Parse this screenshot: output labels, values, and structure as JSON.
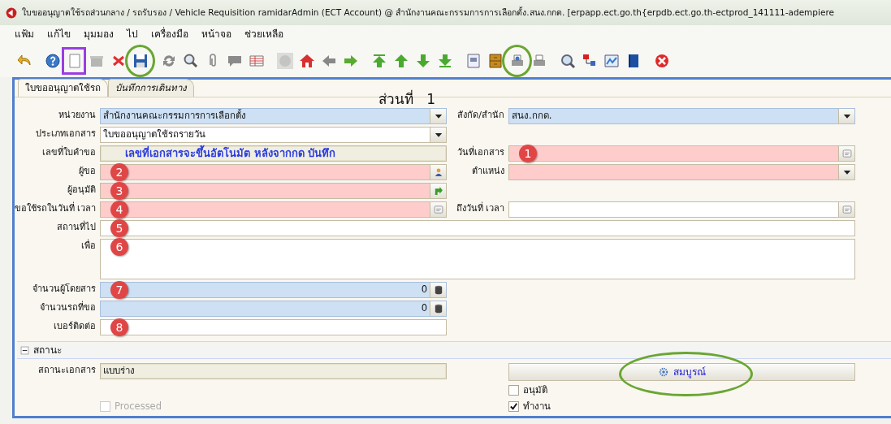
{
  "window": {
    "title": "ใบขออนุญาตใช้รถส่วนกลาง / รถรับรอง / Vehicle Requisition  ramidarAdmin (ECT Account) @ สำนักงานคณะกรรมการการเลือกตั้ง.สนง.กกต. [erpapp.ect.go.th{erpdb.ect.go.th-ectprod_141111-adempiere"
  },
  "menu": [
    "แฟ้ม",
    "แก้ไข",
    "มุมมอง",
    "ไป",
    "เครื่องมือ",
    "หน้าจอ",
    "ช่วยเหลือ"
  ],
  "toolbar": [
    {
      "kind": "undo",
      "disabled": false
    },
    {
      "kind": "help",
      "disabled": false
    },
    {
      "kind": "new",
      "disabled": false,
      "boxed": true
    },
    {
      "kind": "copy",
      "disabled": true
    },
    {
      "kind": "delete",
      "disabled": false
    },
    {
      "kind": "save",
      "disabled": false,
      "circled": true
    },
    {
      "kind": "refresh",
      "disabled": false
    },
    {
      "kind": "search",
      "disabled": false
    },
    {
      "kind": "attach",
      "disabled": false
    },
    {
      "kind": "chat",
      "disabled": false
    },
    {
      "kind": "grid",
      "disabled": false
    },
    {
      "kind": "history",
      "disabled": true
    },
    {
      "kind": "home",
      "disabled": false
    },
    {
      "kind": "left",
      "disabled": false
    },
    {
      "kind": "right",
      "disabled": false
    },
    {
      "kind": "first",
      "disabled": false
    },
    {
      "kind": "up",
      "disabled": false
    },
    {
      "kind": "down",
      "disabled": false
    },
    {
      "kind": "last",
      "disabled": false
    },
    {
      "kind": "report",
      "disabled": false
    },
    {
      "kind": "cabinet",
      "disabled": false
    },
    {
      "kind": "preview",
      "disabled": false,
      "circled": true
    },
    {
      "kind": "print",
      "disabled": false
    },
    {
      "kind": "zoom",
      "disabled": false
    },
    {
      "kind": "flow",
      "disabled": false
    },
    {
      "kind": "picture",
      "disabled": false
    },
    {
      "kind": "book",
      "disabled": false
    },
    {
      "kind": "close",
      "disabled": false
    }
  ],
  "tabs": [
    {
      "label": "ใบขออนุญาตใช้รถ",
      "selected": true
    },
    {
      "label": "บันทึกการเดินทาง",
      "selected": false
    }
  ],
  "section_title": "ส่วนที่   1",
  "rows": [
    {
      "left": {
        "label": "หน่วยงาน",
        "value": "สำนักงานคณะกรรมการการเลือกตั้ง",
        "kind": "select",
        "mandatory": false,
        "readonly": false,
        "highlighted": true
      },
      "right": {
        "label": "สังกัด/สำนัก",
        "value": "สนง.กกด.",
        "kind": "select",
        "mandatory": false,
        "readonly": false,
        "highlighted": true
      }
    },
    {
      "left": {
        "label": "ประเภทเอกสาร",
        "value": "ใบขออนุญาตใช้รถรายวัน",
        "kind": "select",
        "mandatory": false,
        "readonly": false,
        "highlighted": false
      }
    },
    {
      "left": {
        "label": "เลขที่ใบคำขอ",
        "note": "เลขที่เอกสารจะขึ้นอัตโนมัต หลังจากกด บันทึก",
        "kind": "text",
        "mandatory": false,
        "readonly": true,
        "highlighted": false
      },
      "right": {
        "label": "วันที่เอกสาร",
        "kind": "date",
        "mandatory": true,
        "readonly": false,
        "highlighted": false,
        "marker": "1"
      }
    },
    {
      "left": {
        "label": "ผู้ขอ",
        "kind": "person",
        "mandatory": true,
        "readonly": false,
        "highlighted": false,
        "marker": "2"
      },
      "right": {
        "label": "ตำแหน่ง",
        "kind": "select",
        "mandatory": true,
        "readonly": false,
        "highlighted": false
      }
    },
    {
      "left": {
        "label": "ผู้อนุมัติ",
        "kind": "lookup",
        "mandatory": true,
        "readonly": false,
        "highlighted": false,
        "marker": "3"
      }
    },
    {
      "left": {
        "label": "ขอใช้รถในวันที่ เวลา",
        "kind": "date",
        "mandatory": true,
        "readonly": false,
        "highlighted": false,
        "marker": "4"
      },
      "right": {
        "label": "ถึงวันที่ เวลา",
        "kind": "date",
        "mandatory": false,
        "readonly": false,
        "highlighted": false
      }
    },
    {
      "left": {
        "label": "สถานที่ไป",
        "kind": "text",
        "mandatory": false,
        "readonly": false,
        "highlighted": false,
        "wide": true,
        "marker": "5"
      }
    },
    {
      "left": {
        "label": "เพื่อ",
        "kind": "textarea",
        "mandatory": false,
        "readonly": false,
        "highlighted": false,
        "wide": true,
        "marker": "6"
      }
    },
    {
      "left": {
        "label": "จำนวนผู้โดยสาร",
        "value": "0",
        "kind": "number",
        "mandatory": false,
        "readonly": false,
        "highlighted": true,
        "marker": "7"
      }
    },
    {
      "left": {
        "label": "จำนวนรถที่ขอ",
        "value": "0",
        "kind": "number",
        "mandatory": false,
        "readonly": false,
        "highlighted": true
      }
    },
    {
      "left": {
        "label": "เบอร์ติดต่อ",
        "kind": "text",
        "mandatory": false,
        "readonly": false,
        "highlighted": false,
        "marker": "8"
      }
    }
  ],
  "status_section": {
    "title": "สถานะ",
    "expanded": true,
    "field": {
      "label": "สถานะเอกสาร",
      "value": "แบบร่าง",
      "mandatory": false,
      "readonly": true,
      "highlighted": false
    },
    "action": {
      "label": "สมบูรณ์",
      "circled": true
    },
    "checkbox_rows": [
      {
        "right": {
          "label": "อนุมัติ",
          "checked": false,
          "disabled": false
        }
      },
      {
        "left": {
          "label": "Processed",
          "checked": false,
          "disabled": true
        },
        "right": {
          "label": "ทำงาน",
          "checked": true,
          "disabled": false
        }
      }
    ]
  }
}
